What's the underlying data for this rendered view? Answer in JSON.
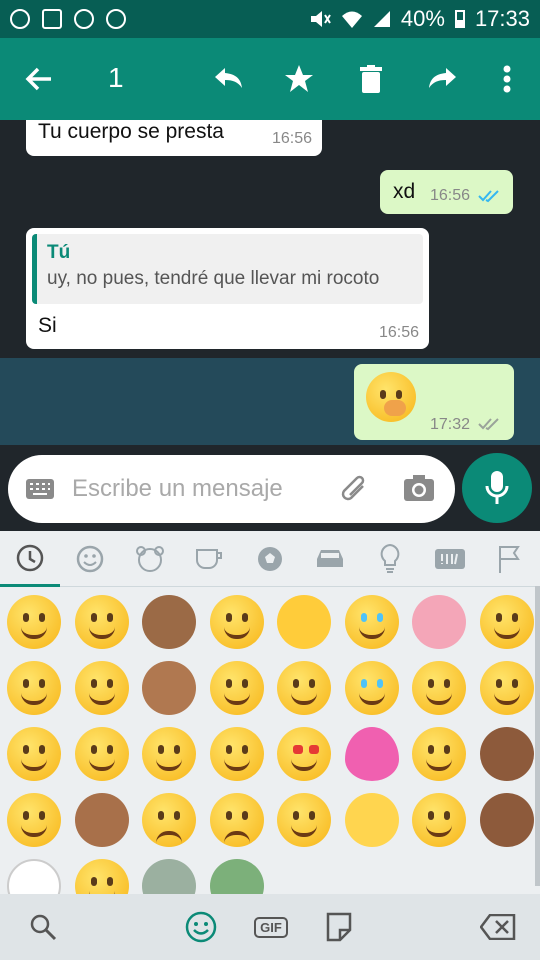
{
  "status_bar": {
    "battery": "40%",
    "time": "17:33"
  },
  "action_bar": {
    "selected_count": "1",
    "icons": [
      "back-arrow-icon",
      "reply-icon",
      "star-icon",
      "delete-icon",
      "forward-icon",
      "more-vert-icon"
    ]
  },
  "messages": [
    {
      "direction": "in",
      "text": "Tu cuerpo se presta",
      "time": "16:56"
    },
    {
      "direction": "out",
      "text": "xd",
      "time": "16:56",
      "ticks": "read"
    },
    {
      "direction": "in",
      "quote_author": "Tú",
      "quote_text": "uy, no pues, tendré que llevar mi rocoto",
      "text": "Si",
      "time": "16:56"
    },
    {
      "direction": "out",
      "text": "",
      "emoji": "face-with-hand-over-mouth",
      "time": "17:32",
      "ticks": "delivered",
      "selected": true
    }
  ],
  "input": {
    "placeholder": "Escribe un mensaje"
  },
  "emoji_panel": {
    "categories": [
      "recent",
      "smileys",
      "animals",
      "food",
      "activity",
      "travel",
      "objects",
      "symbols",
      "flags"
    ],
    "active_category": "recent",
    "emojis": [
      "grinning-face",
      "thinking-face",
      "see-no-evil-monkey",
      "drooling-face",
      "raising-hands",
      "tears-of-joy-face",
      "brain",
      "rolling-on-floor-laughing",
      "face-with-hand-over-mouth",
      "yum-face",
      "clapping-hands",
      "zany-face",
      "smiling-face",
      "loudly-crying-face",
      "confounded-face",
      "face-with-tongue",
      "squinting-laughing-face",
      "grinning-sweat-face",
      "smiling-blush-face",
      "beaming-face",
      "heart-eyes-face",
      "balloon",
      "eye-roll-face",
      "raising-hands-medium-dark",
      "astonished-face",
      "thumbs-up-medium",
      "downcast-sweat-face",
      "confused-face",
      "halo-face",
      "sparkles",
      "winking-face",
      "woman-tipping-hand",
      "eyes",
      "face-with-raised-eyebrow",
      "zombie",
      "money-with-wings"
    ]
  },
  "bottom_bar": {
    "gif_label": "GIF"
  },
  "colors": {
    "header": "#0b8a77",
    "status_bar": "#075e54",
    "chat_bg": "#20262b",
    "outgoing": "#dcf8c6",
    "selected_row": "#244a5a",
    "read_ticks": "#34b7f1"
  }
}
